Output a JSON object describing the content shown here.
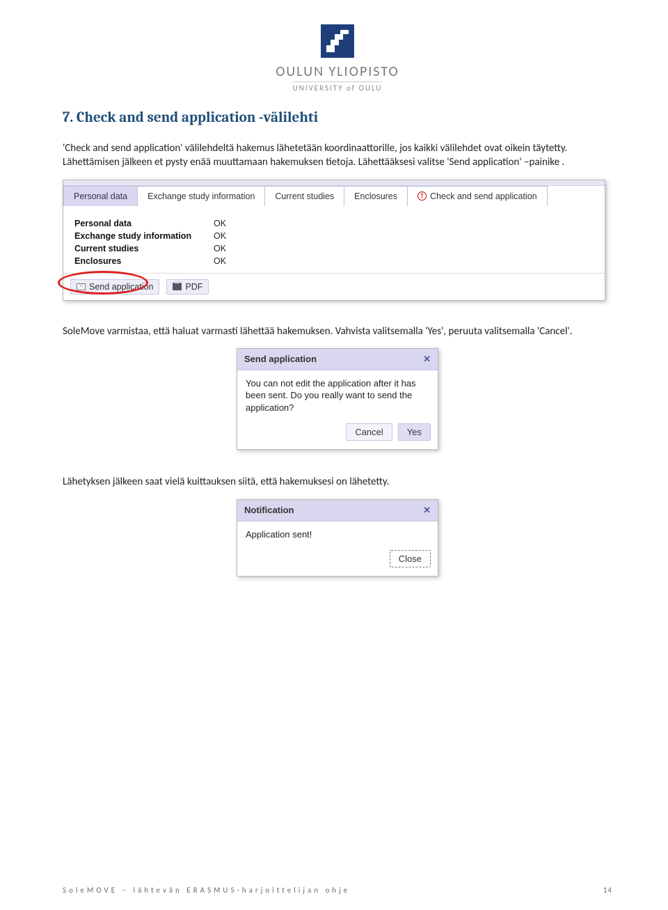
{
  "logo": {
    "line1": "OULUN YLIOPISTO",
    "line2": "UNIVERSITY of OULU"
  },
  "heading": "7. Check and send application -välilehti",
  "para1": "'Check and send application' välilehdeltä hakemus lähetetään koordinaattorille, jos kaikki välilehdet ovat oikein täytetty. Lähettämisen jälkeen et pysty enää muuttamaan hakemuksen tietoja. Lähettääksesi valitse 'Send application' –painike .",
  "shot1": {
    "tabs": [
      "Personal data",
      "Exchange study information",
      "Current studies",
      "Enclosures",
      "Check and send application"
    ],
    "checklist": [
      {
        "label": "Personal data",
        "value": "OK"
      },
      {
        "label": "Exchange study information",
        "value": "OK"
      },
      {
        "label": "Current studies",
        "value": "OK"
      },
      {
        "label": "Enclosures",
        "value": "OK"
      }
    ],
    "actions": {
      "send": "Send application",
      "pdf": "PDF"
    }
  },
  "para2": "SoleMove varmistaa, että haluat varmasti lähettää hakemuksen. Vahvista valitsemalla 'Yes', peruuta valitsemalla 'Cancel'.",
  "dialog1": {
    "title": "Send application",
    "body": "You can not edit the application after it has been sent. Do you really want to send the application?",
    "cancel": "Cancel",
    "yes": "Yes"
  },
  "para3": "Lähetyksen jälkeen saat vielä kuittauksen siitä, että hakemuksesi on lähetetty.",
  "dialog2": {
    "title": "Notification",
    "body": "Application sent!",
    "close": "Close"
  },
  "footer": {
    "text": "SoleMOVE – lähtevän ERASMUS-harjoittelijan ohje",
    "page": "14"
  }
}
